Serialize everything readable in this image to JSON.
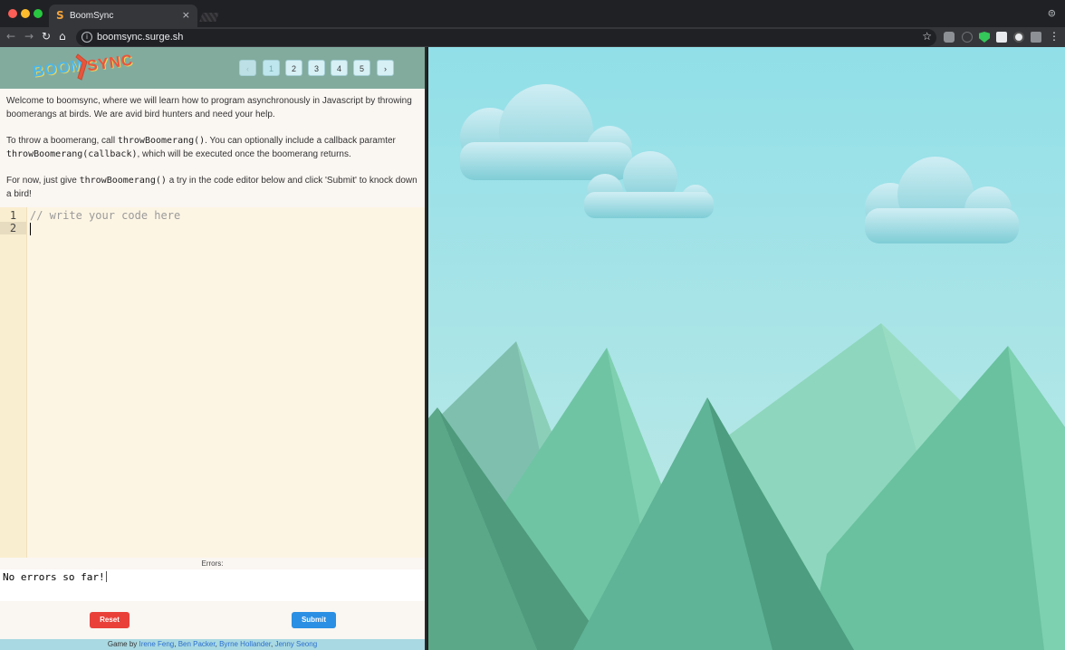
{
  "browser": {
    "tab_title": "BoomSync",
    "tab_favicon": "S",
    "tab_close": "×",
    "url": "boomsync.surge.sh",
    "icons": {
      "back": "back-arrow-icon",
      "forward": "forward-arrow-icon",
      "reload": "reload-icon",
      "home": "home-icon",
      "info": "info-icon",
      "star": "star-icon",
      "menu": "menu-dots-icon"
    }
  },
  "header": {
    "logo_boom": "BOOM",
    "logo_sync": "SYNC",
    "pager": {
      "prev": "‹",
      "next": "›",
      "pages": [
        "1",
        "2",
        "3",
        "4",
        "5"
      ],
      "active_page": "1"
    },
    "colors": {
      "bar": "#82ab9e"
    }
  },
  "instructions": {
    "p1": "Welcome to boomsync, where we will learn how to program asynchronously in Javascript by throwing boomerangs at birds. We are avid bird hunters and need your help.",
    "p2_before": "To throw a boomerang, call ",
    "p2_code1": "throwBoomerang()",
    "p2_mid": ". You can optionally include a callback paramter ",
    "p2_code2": "throwBoomerang(callback)",
    "p2_after": ", which will be executed once the boomerang returns.",
    "p3_before": "For now, just give ",
    "p3_code": "throwBoomerang()",
    "p3_after": " a try in the code editor below and click 'Submit' to knock down a bird!"
  },
  "editor": {
    "line_numbers": [
      "1",
      "2"
    ],
    "lines": [
      "// write your code here",
      ""
    ]
  },
  "errors": {
    "label": "Errors:",
    "text": "No errors so far!"
  },
  "buttons": {
    "reset": "Reset",
    "submit": "Submit",
    "colors": {
      "reset": "#e9413a",
      "submit": "#2b8fe3"
    }
  },
  "footer": {
    "prefix": "Game by ",
    "authors": [
      "Irene Feng",
      "Ben Packer",
      "Byrne Hollander",
      "Jenny Seong"
    ],
    "sep": ", "
  }
}
